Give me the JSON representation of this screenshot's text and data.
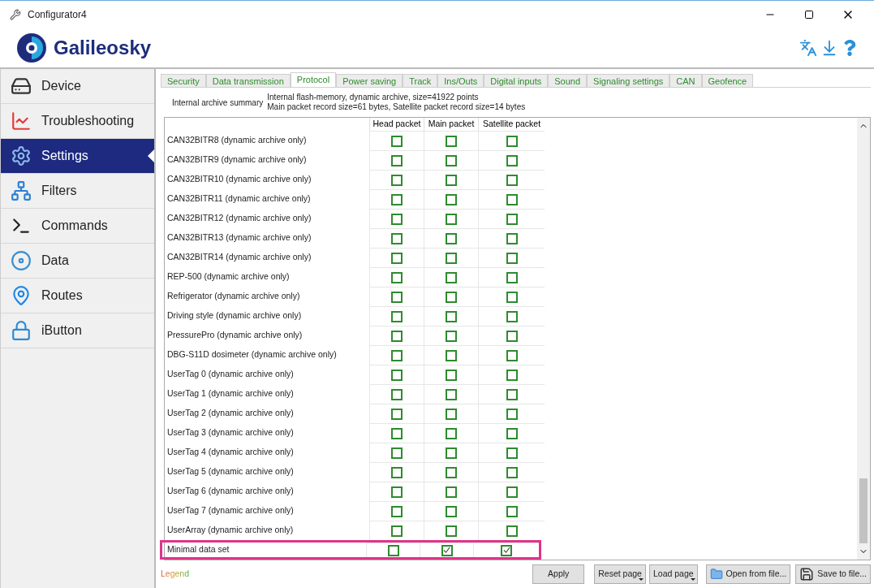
{
  "window": {
    "title": "Configurator4"
  },
  "logo": {
    "text": "Galileosky"
  },
  "sidebar": {
    "items": [
      {
        "label": "Device",
        "selected": false
      },
      {
        "label": "Troubleshooting",
        "selected": false
      },
      {
        "label": "Settings",
        "selected": true
      },
      {
        "label": "Filters",
        "selected": false
      },
      {
        "label": "Commands",
        "selected": false
      },
      {
        "label": "Data",
        "selected": false
      },
      {
        "label": "Routes",
        "selected": false
      },
      {
        "label": "iButton",
        "selected": false
      }
    ]
  },
  "tabs": [
    {
      "label": "Security",
      "selected": false
    },
    {
      "label": "Data transmission",
      "selected": false
    },
    {
      "label": "Protocol",
      "selected": true
    },
    {
      "label": "Power saving",
      "selected": false
    },
    {
      "label": "Track",
      "selected": false
    },
    {
      "label": "Ins/Outs",
      "selected": false
    },
    {
      "label": "Digital inputs",
      "selected": false
    },
    {
      "label": "Sound",
      "selected": false
    },
    {
      "label": "Signaling settings",
      "selected": false
    },
    {
      "label": "CAN",
      "selected": false
    },
    {
      "label": "Geofence",
      "selected": false
    }
  ],
  "summary": {
    "label": "Internal archive summary",
    "lines": [
      "Internal flash-memory, dynamic archive, size=41922 points",
      "Main packet record size=61 bytes, Satellite packet record size=14 bytes"
    ]
  },
  "table": {
    "columns": [
      "Head packet",
      "Main packet",
      "Satellite packet"
    ],
    "rows": [
      {
        "label": "CAN32BITR8 (dynamic archive only)",
        "head": false,
        "main": false,
        "satellite": false,
        "highlighted": false
      },
      {
        "label": "CAN32BITR9 (dynamic archive only)",
        "head": false,
        "main": false,
        "satellite": false,
        "highlighted": false
      },
      {
        "label": "CAN32BITR10 (dynamic archive only)",
        "head": false,
        "main": false,
        "satellite": false,
        "highlighted": false
      },
      {
        "label": "CAN32BITR11 (dynamic archive only)",
        "head": false,
        "main": false,
        "satellite": false,
        "highlighted": false
      },
      {
        "label": "CAN32BITR12 (dynamic archive only)",
        "head": false,
        "main": false,
        "satellite": false,
        "highlighted": false
      },
      {
        "label": "CAN32BITR13 (dynamic archive only)",
        "head": false,
        "main": false,
        "satellite": false,
        "highlighted": false
      },
      {
        "label": "CAN32BITR14 (dynamic archive only)",
        "head": false,
        "main": false,
        "satellite": false,
        "highlighted": false
      },
      {
        "label": "REP-500 (dynamic archive only)",
        "head": false,
        "main": false,
        "satellite": false,
        "highlighted": false
      },
      {
        "label": "Refrigerator (dynamic archive only)",
        "head": false,
        "main": false,
        "satellite": false,
        "highlighted": false
      },
      {
        "label": "Driving style (dynamic archive only)",
        "head": false,
        "main": false,
        "satellite": false,
        "highlighted": false
      },
      {
        "label": "PressurePro (dynamic archive only)",
        "head": false,
        "main": false,
        "satellite": false,
        "highlighted": false
      },
      {
        "label": "DBG-S11D dosimeter (dynamic archive only)",
        "head": false,
        "main": false,
        "satellite": false,
        "highlighted": false
      },
      {
        "label": "UserTag 0 (dynamic archive only)",
        "head": false,
        "main": false,
        "satellite": false,
        "highlighted": false
      },
      {
        "label": "UserTag 1 (dynamic archive only)",
        "head": false,
        "main": false,
        "satellite": false,
        "highlighted": false
      },
      {
        "label": "UserTag 2 (dynamic archive only)",
        "head": false,
        "main": false,
        "satellite": false,
        "highlighted": false
      },
      {
        "label": "UserTag 3 (dynamic archive only)",
        "head": false,
        "main": false,
        "satellite": false,
        "highlighted": false
      },
      {
        "label": "UserTag 4 (dynamic archive only)",
        "head": false,
        "main": false,
        "satellite": false,
        "highlighted": false
      },
      {
        "label": "UserTag 5 (dynamic archive only)",
        "head": false,
        "main": false,
        "satellite": false,
        "highlighted": false
      },
      {
        "label": "UserTag 6 (dynamic archive only)",
        "head": false,
        "main": false,
        "satellite": false,
        "highlighted": false
      },
      {
        "label": "UserTag 7 (dynamic archive only)",
        "head": false,
        "main": false,
        "satellite": false,
        "highlighted": false
      },
      {
        "label": "UserArray (dynamic archive only)",
        "head": false,
        "main": false,
        "satellite": false,
        "highlighted": false
      },
      {
        "label": "Minimal data set",
        "head": false,
        "main": true,
        "satellite": true,
        "highlighted": true
      }
    ]
  },
  "footer": {
    "legend": "Legend",
    "buttons": [
      {
        "label": "Apply",
        "kind": "plain"
      },
      {
        "label": "Reset page",
        "kind": "dropdown"
      },
      {
        "label": "Load page",
        "kind": "dropdown"
      },
      {
        "label": "Open from file...",
        "kind": "open"
      },
      {
        "label": "Save to file...",
        "kind": "save"
      }
    ]
  }
}
